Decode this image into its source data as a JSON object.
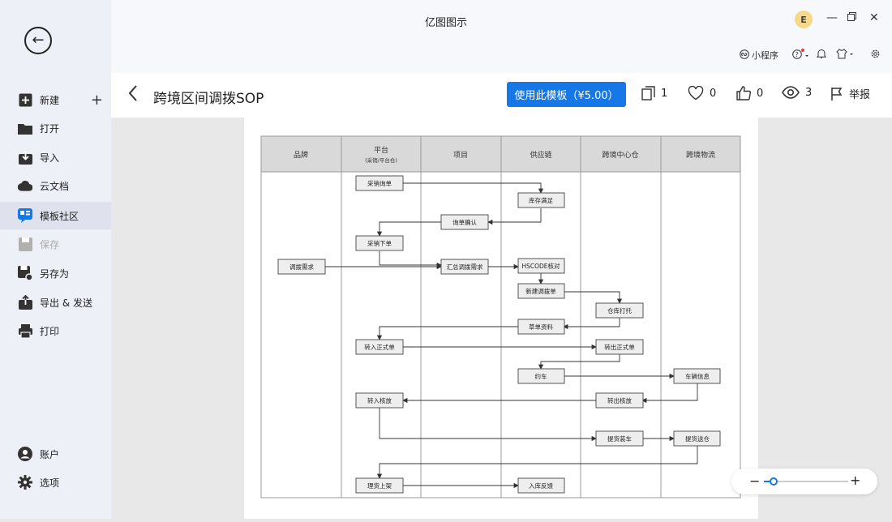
{
  "app": {
    "title": "亿图图示",
    "avatar_letter": "E"
  },
  "sidebar": {
    "items": [
      {
        "label": "新建",
        "icon": "plus-square-icon"
      },
      {
        "label": "打开",
        "icon": "folder-icon"
      },
      {
        "label": "导入",
        "icon": "import-icon"
      },
      {
        "label": "云文档",
        "icon": "cloud-icon"
      },
      {
        "label": "模板社区",
        "icon": "template-community-icon"
      },
      {
        "label": "保存",
        "icon": "save-icon"
      },
      {
        "label": "另存为",
        "icon": "save-as-icon"
      },
      {
        "label": "导出 & 发送",
        "icon": "export-icon"
      },
      {
        "label": "打印",
        "icon": "print-icon"
      }
    ],
    "bottom": [
      {
        "label": "账户",
        "icon": "account-icon"
      },
      {
        "label": "选项",
        "icon": "gear-icon"
      }
    ]
  },
  "toolbar": {
    "mini_program": "小程序"
  },
  "template": {
    "title": "跨境区间调拨SOP",
    "use_button": "使用此模板（¥5.00）",
    "copies": "1",
    "favorites": "0",
    "likes": "0",
    "views": "3",
    "report": "举报"
  },
  "diagram": {
    "lanes": [
      {
        "title": "品牌",
        "sub": ""
      },
      {
        "title": "平台",
        "sub": "(采销/平台仓)"
      },
      {
        "title": "项目",
        "sub": ""
      },
      {
        "title": "供应链",
        "sub": ""
      },
      {
        "title": "跨境中心仓",
        "sub": ""
      },
      {
        "title": "跨境物流",
        "sub": ""
      }
    ],
    "boxes": {
      "b1": "采销询单",
      "b2": "库存满足",
      "b3": "询单确认",
      "b4": "采销下单",
      "b5": "调拨需求",
      "b6": "汇总调拨需求",
      "b7": "HSCODE核对",
      "b8": "新建调拨单",
      "b9": "仓库打托",
      "b10": "草单资料",
      "b11": "转入正式单",
      "b12": "转出正式单",
      "b13": "约车",
      "b14": "车辆信息",
      "b15": "转入核放",
      "b16": "转出核放",
      "b17": "提货装车",
      "b18": "提货送仓",
      "b19": "理货上架",
      "b20": "入库反馈"
    }
  },
  "colors": {
    "accent": "#1677e6",
    "lane_header": "#d9d9d9"
  }
}
